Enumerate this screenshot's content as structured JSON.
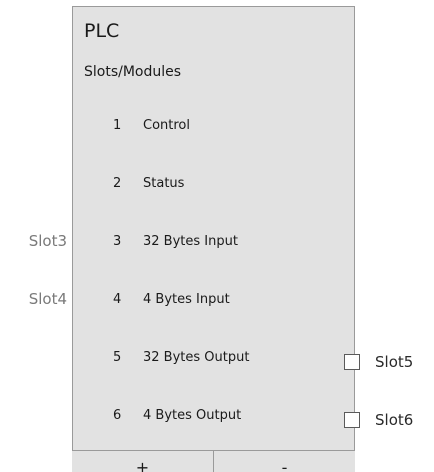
{
  "panel": {
    "title": "PLC",
    "subtitle": "Slots/Modules"
  },
  "slots": [
    {
      "number": "1",
      "name": "Control"
    },
    {
      "number": "2",
      "name": "Status"
    },
    {
      "number": "3",
      "name": "32 Bytes Input"
    },
    {
      "number": "4",
      "name": "4 Bytes Input"
    },
    {
      "number": "5",
      "name": "32 Bytes Output"
    },
    {
      "number": "6",
      "name": "4 Bytes Output"
    }
  ],
  "left_labels": {
    "slot3": "Slot3",
    "slot4": "Slot4"
  },
  "right_slots": {
    "slot5": "Slot5",
    "slot6": "Slot6"
  },
  "buttons": {
    "add_label": "+",
    "remove_label": "-"
  }
}
